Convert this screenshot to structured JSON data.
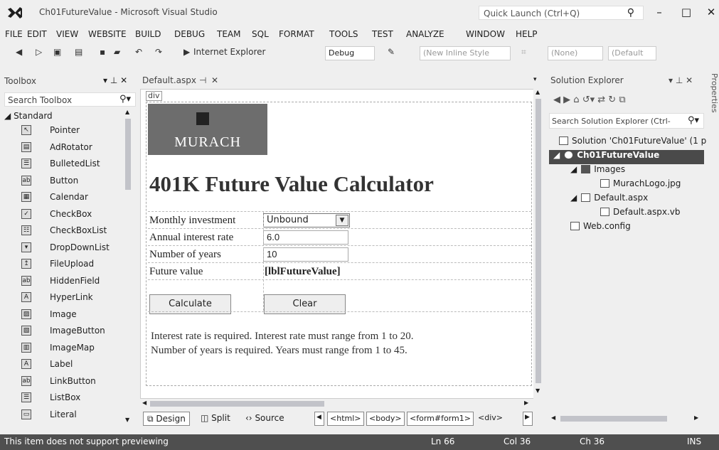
{
  "window": {
    "title": "Ch01FutureValue - Microsoft Visual Studio",
    "quick_launch": "Quick Launch (Ctrl+Q)",
    "controls": {
      "minimize": "–",
      "maximize": "□",
      "close": "✕"
    }
  },
  "menu": [
    "FILE",
    "EDIT",
    "VIEW",
    "WEBSITE",
    "BUILD",
    "DEBUG",
    "TEAM",
    "SQL",
    "FORMAT",
    "TOOLS",
    "TEST",
    "ANALYZE",
    "WINDOW",
    "HELP"
  ],
  "toolbar": {
    "browser": "Internet Explorer",
    "config": "Debug",
    "inline_style": "(New Inline Style",
    "target": "(None)",
    "font": "(Default"
  },
  "toolbox": {
    "title": "Toolbox",
    "search_placeholder": "Search Toolbox",
    "section": "Standard",
    "items": [
      {
        "label": "Pointer",
        "icon": "pointer-icon",
        "glyph": "↖"
      },
      {
        "label": "AdRotator",
        "icon": "adrotator-icon",
        "glyph": "▤"
      },
      {
        "label": "BulletedList",
        "icon": "bulleted-list-icon",
        "glyph": "☰"
      },
      {
        "label": "Button",
        "icon": "button-icon",
        "glyph": "ab"
      },
      {
        "label": "Calendar",
        "icon": "calendar-icon",
        "glyph": "▦"
      },
      {
        "label": "CheckBox",
        "icon": "checkbox-icon",
        "glyph": "✓"
      },
      {
        "label": "CheckBoxList",
        "icon": "checkbox-list-icon",
        "glyph": "☷"
      },
      {
        "label": "DropDownList",
        "icon": "dropdown-list-icon",
        "glyph": "▾"
      },
      {
        "label": "FileUpload",
        "icon": "file-upload-icon",
        "glyph": "↥"
      },
      {
        "label": "HiddenField",
        "icon": "hidden-field-icon",
        "glyph": "ab"
      },
      {
        "label": "HyperLink",
        "icon": "hyperlink-icon",
        "glyph": "A"
      },
      {
        "label": "Image",
        "icon": "image-icon",
        "glyph": "▨"
      },
      {
        "label": "ImageButton",
        "icon": "image-button-icon",
        "glyph": "▧"
      },
      {
        "label": "ImageMap",
        "icon": "image-map-icon",
        "glyph": "▥"
      },
      {
        "label": "Label",
        "icon": "label-icon",
        "glyph": "A"
      },
      {
        "label": "LinkButton",
        "icon": "link-button-icon",
        "glyph": "ab"
      },
      {
        "label": "ListBox",
        "icon": "listbox-icon",
        "glyph": "☰"
      },
      {
        "label": "Literal",
        "icon": "literal-icon",
        "glyph": "▭"
      }
    ]
  },
  "editor": {
    "tab_label": "Default.aspx",
    "div_tag": "div",
    "logo_text": "MURACH",
    "heading": "401K Future Value Calculator",
    "rows": [
      {
        "label": "Monthly investment",
        "value": "Unbound"
      },
      {
        "label": "Annual interest rate",
        "value": "6.0"
      },
      {
        "label": "Number of years",
        "value": "10"
      },
      {
        "label": "Future value",
        "value": "[lblFutureValue]"
      }
    ],
    "calculate_label": "Calculate",
    "clear_label": "Clear",
    "messages": [
      "Interest rate is required.  Interest rate must range from 1 to 20.",
      "Number of years is required. Years must range from 1 to 45."
    ],
    "view_buttons": {
      "design": "Design",
      "split": "Split",
      "source": "Source"
    },
    "breadcrumbs": [
      "<html>",
      "<body>",
      "<form#form1>",
      "<div>"
    ]
  },
  "solution_explorer": {
    "title": "Solution Explorer",
    "search_placeholder": "Search Solution Explorer (Ctrl-",
    "tree": [
      {
        "label": "Solution 'Ch01FutureValue' (1 p",
        "icon": "solution-icon",
        "selected": false
      },
      {
        "label": "Ch01FutureValue",
        "icon": "website-icon",
        "selected": true
      },
      {
        "label": "Images",
        "icon": "folder-icon",
        "selected": false
      },
      {
        "label": "MurachLogo.jpg",
        "icon": "image-file-icon",
        "selected": false
      },
      {
        "label": "Default.aspx",
        "icon": "aspx-file-icon",
        "selected": false
      },
      {
        "label": "Default.aspx.vb",
        "icon": "vb-file-icon",
        "selected": false
      },
      {
        "label": "Web.config",
        "icon": "config-file-icon",
        "selected": false
      }
    ],
    "properties_tab": "Properties"
  },
  "status": {
    "message": "This item does not support previewing",
    "line": "Ln 66",
    "col": "Col 36",
    "ch": "Ch 36",
    "mode": "INS"
  },
  "colors": {
    "status_bg": "#4f4f4f",
    "selected_node": "#4a4a4a",
    "chrome_bg": "#efefef"
  }
}
